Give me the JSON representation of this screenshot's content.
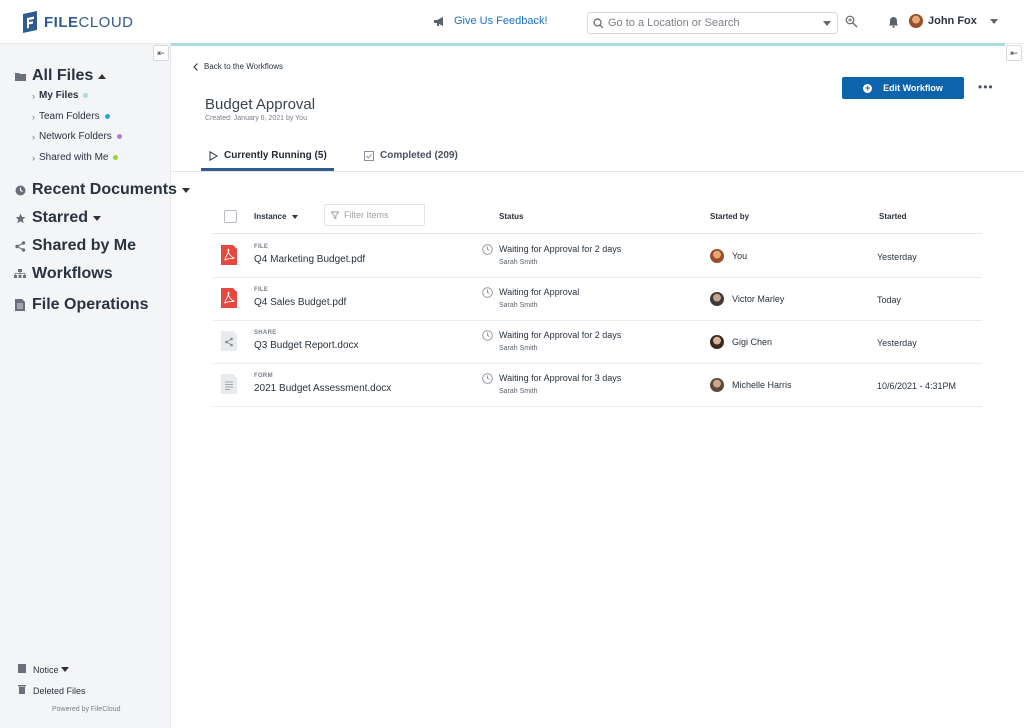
{
  "header": {
    "logo_bold": "FILE",
    "logo_light": "CLOUD",
    "feedback": "Give Us Feedback!",
    "search_placeholder": "Go to a Location or Search",
    "user_name": "John Fox"
  },
  "sidebar": {
    "all_files": "All Files",
    "sub_items": [
      {
        "label": "My Files",
        "color": "#a8dde0"
      },
      {
        "label": "Team Folders",
        "color": "#2aa3e6"
      },
      {
        "label": "Network Folders",
        "color": "#b27ce6"
      },
      {
        "label": "Shared with Me",
        "color": "#9bd13a"
      }
    ],
    "recent": "Recent Documents",
    "starred": "Starred",
    "shared_by_me": "Shared by Me",
    "workflows": "Workflows",
    "file_operations": "File Operations",
    "notice": "Notice",
    "deleted_files": "Deleted Files",
    "powered_by": "Powered by FileCloud"
  },
  "main": {
    "back": "Back to the Workflows",
    "title": "Budget Approval",
    "subtitle": "Created: January 6, 2021 by You",
    "edit_button": "Edit Workflow",
    "more": "•••",
    "tabs": [
      {
        "label": "Currently Running (5)"
      },
      {
        "label": "Completed (209)"
      }
    ]
  },
  "table": {
    "columns": {
      "instance": "Instance",
      "filter_placeholder": "Filter Items",
      "status": "Status",
      "started_by": "Started by",
      "started": "Started"
    },
    "rows": [
      {
        "type": "FILE",
        "name": "Q4 Marketing Budget.pdf",
        "icon": "pdf-icon",
        "status": "Waiting for Approval for 2 days",
        "assignee": "Sarah Smith",
        "started_by": "You",
        "started": "Yesterday"
      },
      {
        "type": "FILE",
        "name": "Q4 Sales Budget.pdf",
        "icon": "pdf-icon",
        "status": "Waiting for Approval",
        "assignee": "Sarah Smith",
        "started_by": "Victor Marley",
        "started": "Today"
      },
      {
        "type": "SHARE",
        "name": "Q3 Budget Report.docx",
        "icon": "share-doc-icon",
        "status": "Waiting for Approval for 2 days",
        "assignee": "Sarah Smith",
        "started_by": "Gigi Chen",
        "started": "Yesterday"
      },
      {
        "type": "FORM",
        "name": "2021 Budget Assessment.docx",
        "icon": "form-doc-icon",
        "status": "Waiting for Approval for 3 days",
        "assignee": "Sarah Smith",
        "started_by": "Michelle Harris",
        "started": "10/6/2021 - 4:31PM"
      }
    ]
  }
}
